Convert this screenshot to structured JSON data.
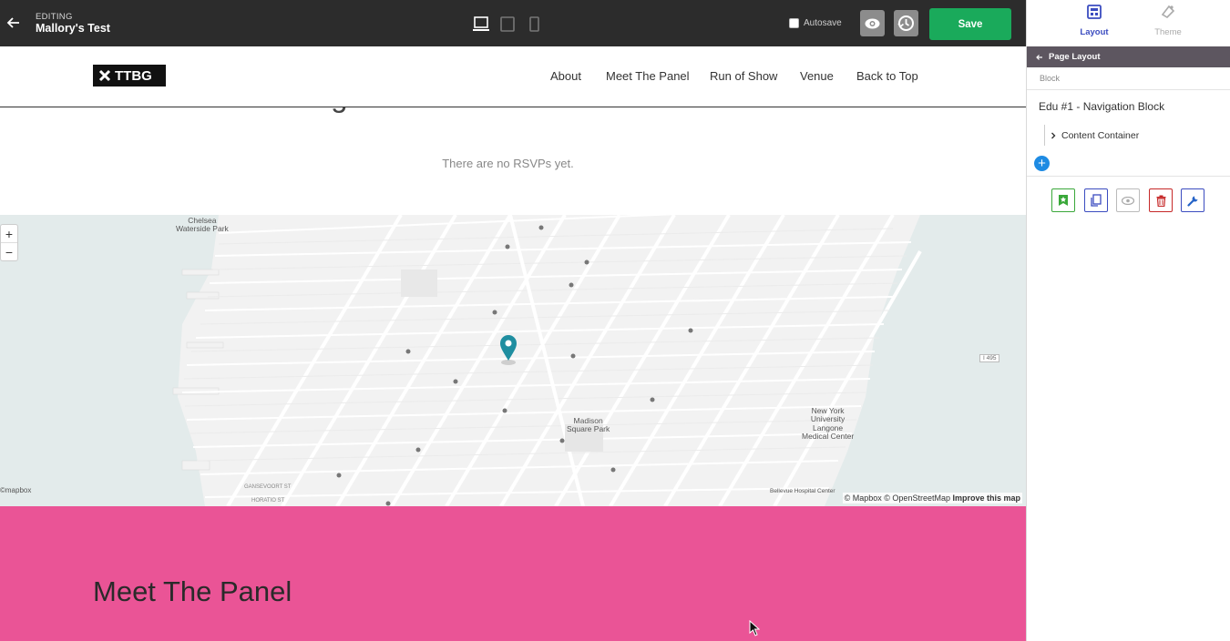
{
  "editor": {
    "editing_label": "EDITING",
    "page_title": "Mallory's Test",
    "autosave_label": "Autosave",
    "save_label": "Save"
  },
  "site": {
    "logo_text": "TTBG",
    "nav": [
      "About",
      "Meet The Panel",
      "Run of Show",
      "Venue",
      "Back to Top"
    ],
    "peek_heading": "See Who's Coming",
    "rsvp_empty": "There are no RSVPs yet.",
    "panel_heading": "Meet The Panel"
  },
  "map": {
    "zoom_in": "+",
    "zoom_out": "−",
    "labels": {
      "chelsea": "Chelsea\nWaterside Park",
      "madison": "Madison\nSquare Park",
      "nyu": "New York\nUniversity\nLangone\nMedical Center",
      "bellevue": "Bellevue Hospital Center",
      "gansevoort": "GANSEVOORT ST",
      "horatio": "HORATIO ST",
      "i495": "I 495",
      "mapbox_logo": "©mapbox"
    },
    "attribution": {
      "text": "© Mapbox © OpenStreetMap ",
      "improve": "Improve this map"
    }
  },
  "sidebar": {
    "tab_layout": "Layout",
    "tab_theme": "Theme",
    "page_layout": "Page Layout",
    "block_label": "Block",
    "block_name": "Edu #1 - Navigation Block",
    "tree_item": "Content Container",
    "add": "+"
  },
  "colors": {
    "topbar": "#2c2c2c",
    "save": "#1aaa5b",
    "pink": "#ea5496",
    "accent": "#3b4cc0",
    "sidebar_header": "#5d5660"
  }
}
